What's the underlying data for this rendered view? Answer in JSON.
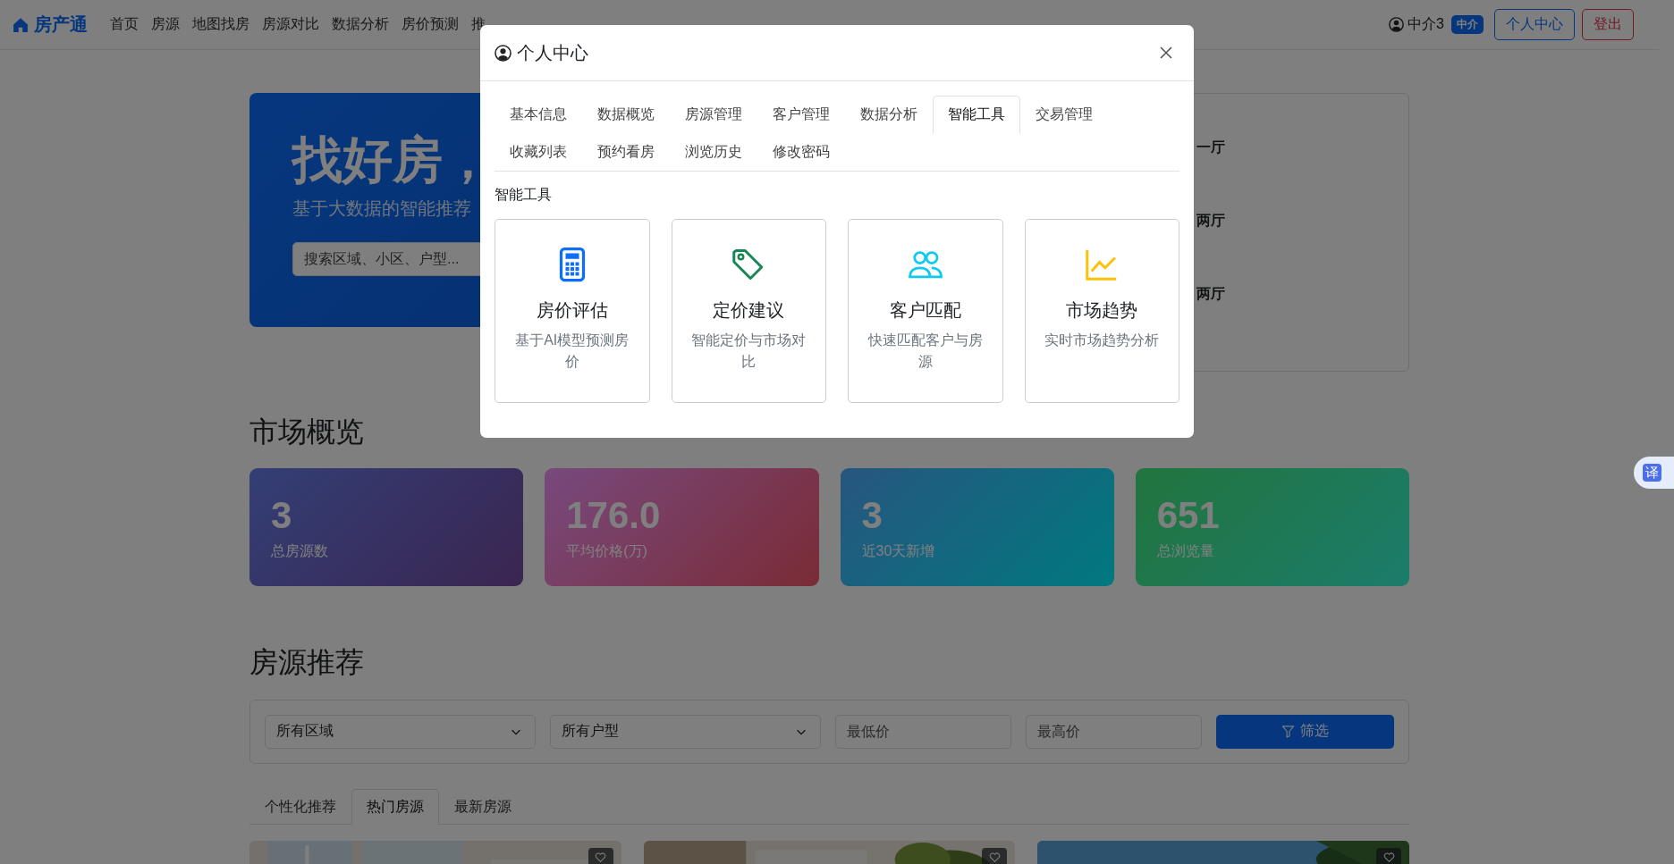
{
  "navbar": {
    "brand": "房产通",
    "links": [
      {
        "label": "首页"
      },
      {
        "label": "房源"
      },
      {
        "label": "地图找房"
      },
      {
        "label": "房源对比"
      },
      {
        "label": "数据分析"
      },
      {
        "label": "房价预测"
      },
      {
        "label": "推"
      }
    ],
    "user": {
      "name": "中介3",
      "badge": "中介"
    },
    "buttons": [
      {
        "label": "个人中心",
        "kind": "primary"
      },
      {
        "label": "登出",
        "kind": "danger"
      }
    ]
  },
  "hero": {
    "title": "找好房，",
    "subtitle": "基于大数据的智能推荐",
    "search": {
      "placeholder": "搜索区域、小区、户型..."
    }
  },
  "side_card": {
    "items": [
      "一厅",
      "两厅",
      "两厅"
    ]
  },
  "market_overview": {
    "title": "市场概览",
    "stats": [
      {
        "value": "3",
        "label": "总房源数"
      },
      {
        "value": "176.0",
        "label": "平均价格(万)"
      },
      {
        "value": "3",
        "label": "近30天新增"
      },
      {
        "value": "651",
        "label": "总浏览量"
      }
    ]
  },
  "recommendations": {
    "title": "房源推荐",
    "filters": {
      "region": {
        "value": "所有区域"
      },
      "layout": {
        "value": "所有户型"
      },
      "min_price": {
        "placeholder": "最低价"
      },
      "max_price": {
        "placeholder": "最高价"
      },
      "button": "筛选"
    },
    "tabs": [
      {
        "label": "个性化推荐",
        "selected": false
      },
      {
        "label": "热门房源",
        "selected": true
      },
      {
        "label": "最新房源",
        "selected": false
      }
    ]
  },
  "translate_button": "译",
  "modal": {
    "title": "个人中心",
    "tabs": [
      {
        "label": "基本信息",
        "selected": false
      },
      {
        "label": "数据概览",
        "selected": false
      },
      {
        "label": "房源管理",
        "selected": false
      },
      {
        "label": "客户管理",
        "selected": false
      },
      {
        "label": "数据分析",
        "selected": false
      },
      {
        "label": "智能工具",
        "selected": true
      },
      {
        "label": "交易管理",
        "selected": false
      },
      {
        "label": "收藏列表",
        "selected": false
      },
      {
        "label": "预约看房",
        "selected": false
      },
      {
        "label": "浏览历史",
        "selected": false
      },
      {
        "label": "修改密码",
        "selected": false
      }
    ],
    "section_title": "智能工具",
    "tools": [
      {
        "title": "房价评估",
        "description": "基于AI模型预测房价"
      },
      {
        "title": "定价建议",
        "description": "智能定价与市场对比"
      },
      {
        "title": "客户匹配",
        "description": "快速匹配客户与房源"
      },
      {
        "title": "市场趋势",
        "description": "实时市场趋势分析"
      }
    ]
  }
}
